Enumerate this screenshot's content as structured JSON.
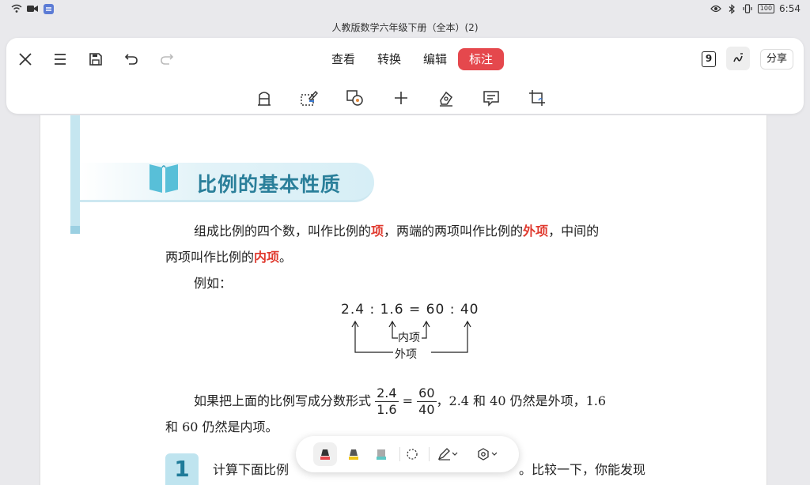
{
  "status": {
    "time": "6:54",
    "battery": "100"
  },
  "title": "人教版数学六年级下册（全本）(2)",
  "toolbar": {
    "close": "close",
    "menu": "menu",
    "save": "save",
    "undo": "undo",
    "redo": "redo",
    "tabs": [
      {
        "label": "查看",
        "active": false
      },
      {
        "label": "转换",
        "active": false
      },
      {
        "label": "编辑",
        "active": false
      },
      {
        "label": "标注",
        "active": true
      }
    ],
    "page_number": "9",
    "share_label": "分享",
    "accent": "#e5484d"
  },
  "content": {
    "section_title": "比例的基本性质",
    "para1_a": "组成比例的四个数，叫作比例的",
    "para1_term1": "项",
    "para1_b": "，两端的两项叫作比例的",
    "para1_term2": "外项",
    "para1_c": "，中间的",
    "para2_a": "两项叫作比例的",
    "para2_term": "内项",
    "para2_b": "。",
    "example_label": "例如：",
    "formula": "2.4 : 1.6 = 60 : 40",
    "inner_label": "内项",
    "outer_label": "外项",
    "para3_a": "如果把上面的比例写成分数形式",
    "frac1_num": "2.4",
    "frac1_den": "1.6",
    "eq": "=",
    "frac2_num": "60",
    "frac2_den": "40",
    "para3_b": "，2.4 和 40 仍然是外项，1.6",
    "para4": "和 60 仍然是内项。",
    "exercise_number": "1",
    "exercise_text": "计算下面比例",
    "exercise_text_end": "。比较一下，你能发现"
  },
  "colors": {
    "highlight": "#e03a2f",
    "title_blue": "#2a7f9a"
  }
}
